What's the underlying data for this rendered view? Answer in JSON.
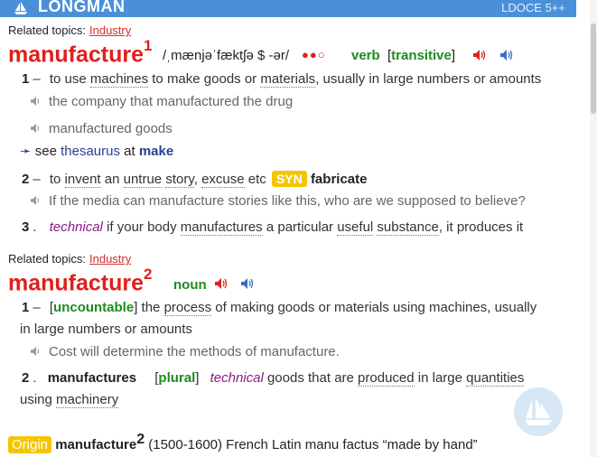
{
  "topbar": {
    "brand": "LONGMAN",
    "version": "LDOCE 5++"
  },
  "entry1": {
    "related_label": "Related topics:",
    "related_topic": "Industry",
    "headword": "manufacture",
    "homnum": "1",
    "pron": "/ˌmænjəˈfæktʃə $ -ər/",
    "freq": "●●○",
    "pos": "verb",
    "gram_open": "[",
    "gram": "transitive",
    "gram_close": "]",
    "sense1": {
      "num": "1",
      "dash": "–",
      "text_a": "to use ",
      "w1": "machines",
      "text_b": " to make goods or ",
      "w2": "materials",
      "text_c": ", usually in large numbers or amounts",
      "ex1": "the company that manufactured the drug",
      "ex2": "manufactured goods"
    },
    "see": {
      "arrow": "➛",
      "see": " see ",
      "thesaurus": "thesaurus",
      "at": " at ",
      "make": "make"
    },
    "sense2": {
      "num": "2",
      "dash": "–",
      "text_a": "to ",
      "w1": "invent",
      "text_b": " an ",
      "w2": "untrue",
      "text_c": " ",
      "w3": "story",
      "text_d": ", ",
      "w4": "excuse",
      "text_e": " etc ",
      "syn": "SYN",
      "fab": "fabricate",
      "ex1": "If the media can manufacture stories like this, who are we supposed to believe?"
    },
    "sense3": {
      "num": "3",
      "dot": ".",
      "register": "technical",
      "text_a": " if your body ",
      "w1": "manufactures",
      "text_b": " a particular ",
      "w2": "useful",
      "text_c": " ",
      "w3": "substance",
      "text_d": ", it produces it"
    }
  },
  "entry2": {
    "related_label": "Related topics:",
    "related_topic": "Industry",
    "headword": "manufacture",
    "homnum": "2",
    "pos": "noun",
    "sense1": {
      "num": "1",
      "dash": "–",
      "gram_open": "[",
      "gram": "uncountable",
      "gram_close": "]",
      "text_a": " the ",
      "w1": "process",
      "text_b": " of making goods or materials using machines, usually",
      "line2": "in large numbers or amounts",
      "ex1": "Cost will determine the methods of manufacture."
    },
    "sense2": {
      "num": "2",
      "dot": ".",
      "form": "manufactures",
      "gram_open": "[",
      "gram": "plural",
      "gram_close": "]",
      "register": "technical",
      "text_a": " goods that are ",
      "w1": "produced",
      "text_b": " in large ",
      "w2": "quantities",
      "line2_a": "using ",
      "line2_w": "machinery"
    }
  },
  "origin": {
    "tag": "Origin",
    "hw": "manufacture",
    "homnum": "2",
    "text": " (1500-1600) French Latin manu factus “made by hand”"
  },
  "icons": {
    "speaker_red": "#e0201b",
    "speaker_blue": "#3a6fc4",
    "speaker_gray": "#999999"
  }
}
